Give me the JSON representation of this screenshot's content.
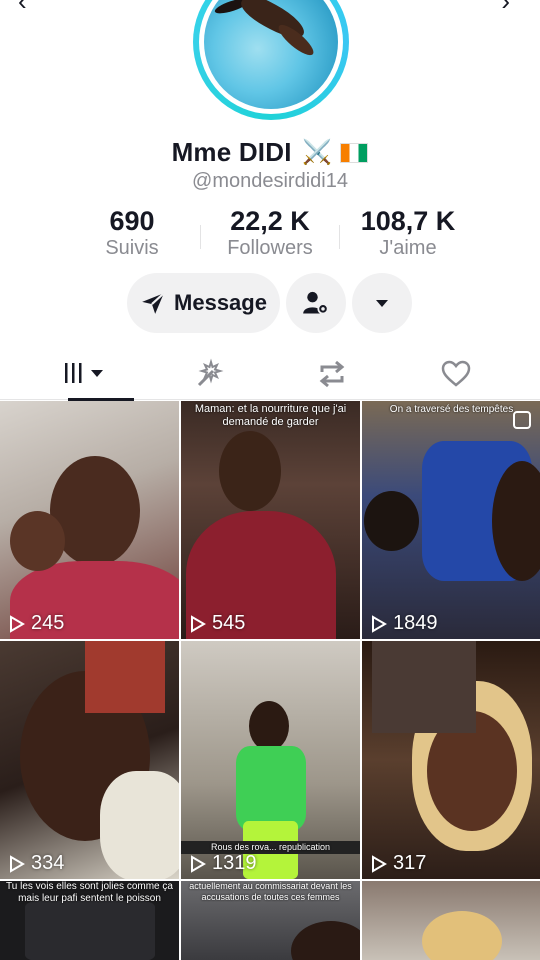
{
  "profile": {
    "name": "Mme DIDI",
    "emoji": "⚔️",
    "handle": "@mondesirdidi14"
  },
  "stats": [
    {
      "value": "690",
      "label": "Suivis"
    },
    {
      "value": "22,2 K",
      "label": "Followers"
    },
    {
      "value": "108,7 K",
      "label": "J'aime"
    }
  ],
  "actions": {
    "message_label": "Message"
  },
  "tabs": [
    {
      "icon": "videos-grid-icon",
      "active": true
    },
    {
      "icon": "reposts-sparkle-icon",
      "active": false
    },
    {
      "icon": "repost-icon",
      "active": false
    },
    {
      "icon": "heart-icon",
      "active": false
    }
  ],
  "videos": [
    {
      "views": "245",
      "caption": ""
    },
    {
      "views": "545",
      "caption": "Maman: et la nourriture que j'ai demandé de garder"
    },
    {
      "views": "1849",
      "caption": "On a traversé des tempêtes"
    },
    {
      "views": "334",
      "caption": ""
    },
    {
      "views": "1319",
      "caption": "Rous des rova... republication"
    },
    {
      "views": "317",
      "caption": ""
    },
    {
      "views": "",
      "caption": "Tu les vois elles sont jolies comme ça mais leur pafi sentent le poisson"
    },
    {
      "views": "",
      "caption": "actuellement au commissariat devant les accusations de toutes ces femmes"
    },
    {
      "views": "",
      "caption": ""
    }
  ],
  "colors": {
    "text": "#161823",
    "muted": "#8a8b91",
    "button_bg": "#f1f1f2",
    "ring": "#25d7e6"
  }
}
